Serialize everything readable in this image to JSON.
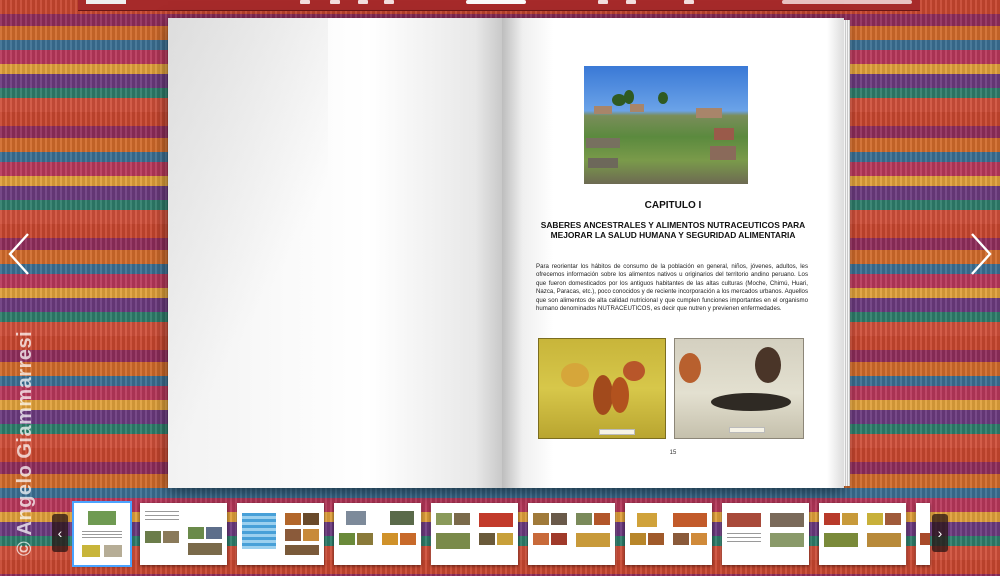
{
  "book": {
    "chapter": "CAPITULO I",
    "subtitle": "SABERES ANCESTRALES Y ALIMENTOS NUTRACEUTICOS PARA MEJORAR LA SALUD HUMANA Y SEGURIDAD ALIMENTARIA",
    "paragraph": "Para reorientar los hábitos de consumo de la población en general, niños, jóvenes, adultos, les ofrecemos información sobre los alimentos nativos u originarios del territorio andino peruano. Los que fueron domesticados por los antiguos habitantes de las altas culturas (Moche, Chimú, Huari, Nazca, Paracas, etc.), poco conocidos y de reciente incorporación a los mercados urbanos. Aquellos que son alimentos de alta calidad nutricional y que cumplen funciones importantes en el organismo humano denominados NUTRACEUTICOS, es decir que nutren y previenen enfermedades.",
    "page_number": "15"
  },
  "watermark": "© Angelo Giammarresi",
  "colors": {
    "toolbar": "#a62a2a",
    "thumb_active_border": "#4aa3ff"
  },
  "icons": {
    "prev_page": "chevron-left-icon",
    "next_page": "chevron-right-icon",
    "thumb_prev": "chevron-left-icon",
    "thumb_next": "chevron-right-icon"
  },
  "thumbnails": {
    "count": 10,
    "active_index": 0
  }
}
